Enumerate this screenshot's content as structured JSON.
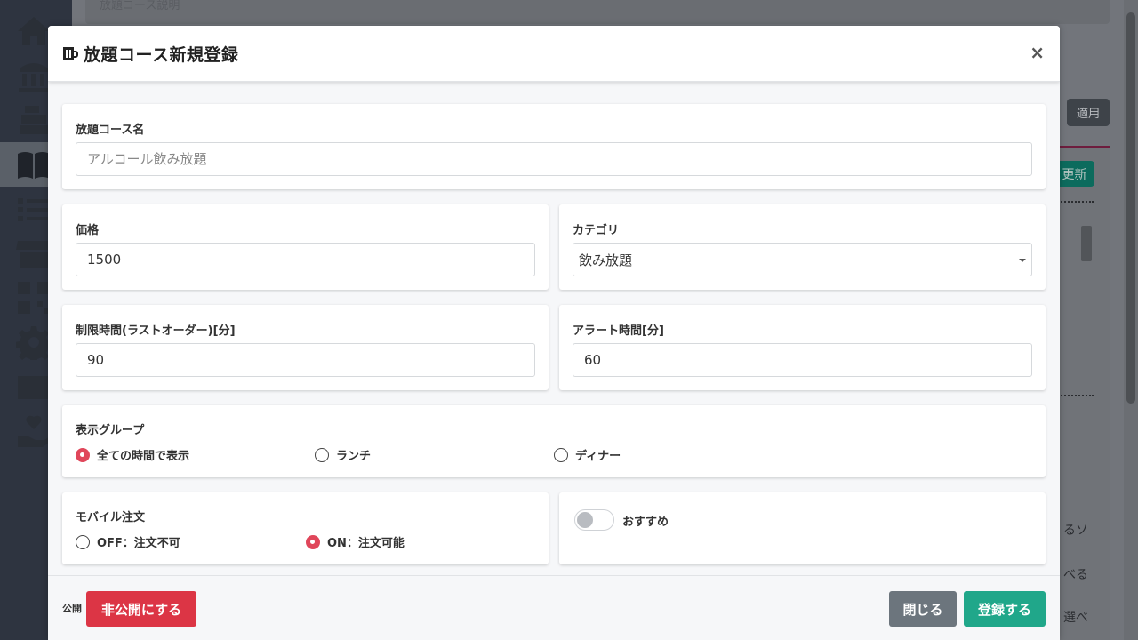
{
  "modal": {
    "title": "放題コース新規登録",
    "close_label": "×"
  },
  "course_name": {
    "label": "放題コース名",
    "placeholder": "アルコール飲み放題"
  },
  "price": {
    "label": "価格",
    "value": "1500"
  },
  "category": {
    "label": "カテゴリ",
    "selected": "飲み放題"
  },
  "time_limit": {
    "label": "制限時間(ラストオーダー)[分]",
    "value": "90"
  },
  "alert_time": {
    "label": "アラート時間[分]",
    "value": "60"
  },
  "display_group": {
    "label": "表示グループ",
    "options": [
      {
        "label": "全ての時間で表示",
        "selected": true
      },
      {
        "label": "ランチ",
        "selected": false
      },
      {
        "label": "ディナー",
        "selected": false
      }
    ]
  },
  "mobile_order": {
    "label": "モバイル注文",
    "options": [
      {
        "label": "OFF：注文不可",
        "selected": false
      },
      {
        "label": "ON：注文可能",
        "selected": true
      }
    ]
  },
  "recommend": {
    "label": "おすすめ",
    "on": false
  },
  "footer": {
    "visibility_label": "公開",
    "unpublish_button": "非公開にする",
    "close_button": "閉じる",
    "register_button": "登録する"
  },
  "background": {
    "description": "放題コース説明",
    "apply_button": "適用",
    "update_button": "更新",
    "snippets": [
      "るソ",
      "べる",
      "選べ"
    ]
  },
  "colors": {
    "danger": "#dc3545",
    "secondary": "#6c757d",
    "success": "#20a78a",
    "radio_checked": "#e0465a"
  }
}
